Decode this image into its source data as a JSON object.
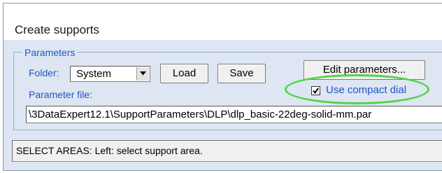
{
  "window": {
    "title": "Create supports"
  },
  "parameters": {
    "legend": "Parameters",
    "folder_label": "Folder:",
    "folder_value": "System",
    "load_label": "Load",
    "save_label": "Save",
    "edit_label": "Edit parameters...",
    "compact_dial_label": "Use compact dial",
    "compact_dial_checked": true,
    "param_file_label": "Parameter file:",
    "param_file_value": "\\3DataExpert12.1\\SupportParameters\\DLP\\dlp_basic-22deg-solid-mm.par"
  },
  "status": {
    "text": "SELECT AREAS: Left: select support area."
  },
  "colors": {
    "highlight": "#4fd44a",
    "label": "#2056c7",
    "panel": "#dde6f2"
  }
}
